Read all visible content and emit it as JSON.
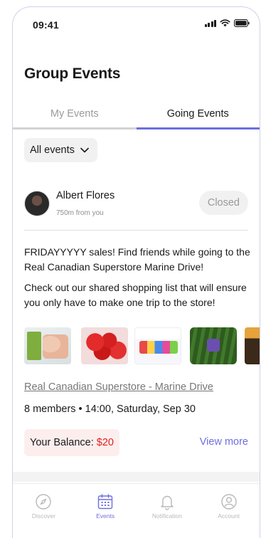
{
  "status_bar": {
    "time": "09:41"
  },
  "page_title": "Group Events",
  "tabs": [
    {
      "label": "My Events",
      "active": false
    },
    {
      "label": "Going Events",
      "active": true
    }
  ],
  "filter": {
    "label": "All events"
  },
  "event": {
    "host_name": "Albert Flores",
    "host_distance": "750m from you",
    "status": "Closed",
    "title": "FRIDAYYYYY sales! Find friends while going to the Real Canadian Superstore Marine Drive!",
    "description": "Check out our shared shopping list that will ensure you only have to make one trip to the store!",
    "products": [
      "chicken-breast-pack",
      "cherry-tomatoes",
      "yogurt-multipack",
      "cucumbers-pack",
      "snack-box"
    ],
    "store": "Real Canadian Superstore - Marine Drive",
    "meta": "8 members • 14:00, Saturday, Sep 30",
    "balance_label": "Your Balance:",
    "balance_amount": "$20",
    "view_more": "View more"
  },
  "bottom_nav": [
    {
      "label": "Discover",
      "icon": "compass-icon",
      "active": false
    },
    {
      "label": "Events",
      "icon": "calendar-icon",
      "active": true
    },
    {
      "label": "Notification",
      "icon": "bell-icon",
      "active": false
    },
    {
      "label": "Account",
      "icon": "user-icon",
      "active": false
    }
  ],
  "colors": {
    "accent": "#6e6ee0",
    "balance_text": "#e02020",
    "balance_bg": "#fdeeee",
    "muted": "#9a9a9a"
  }
}
